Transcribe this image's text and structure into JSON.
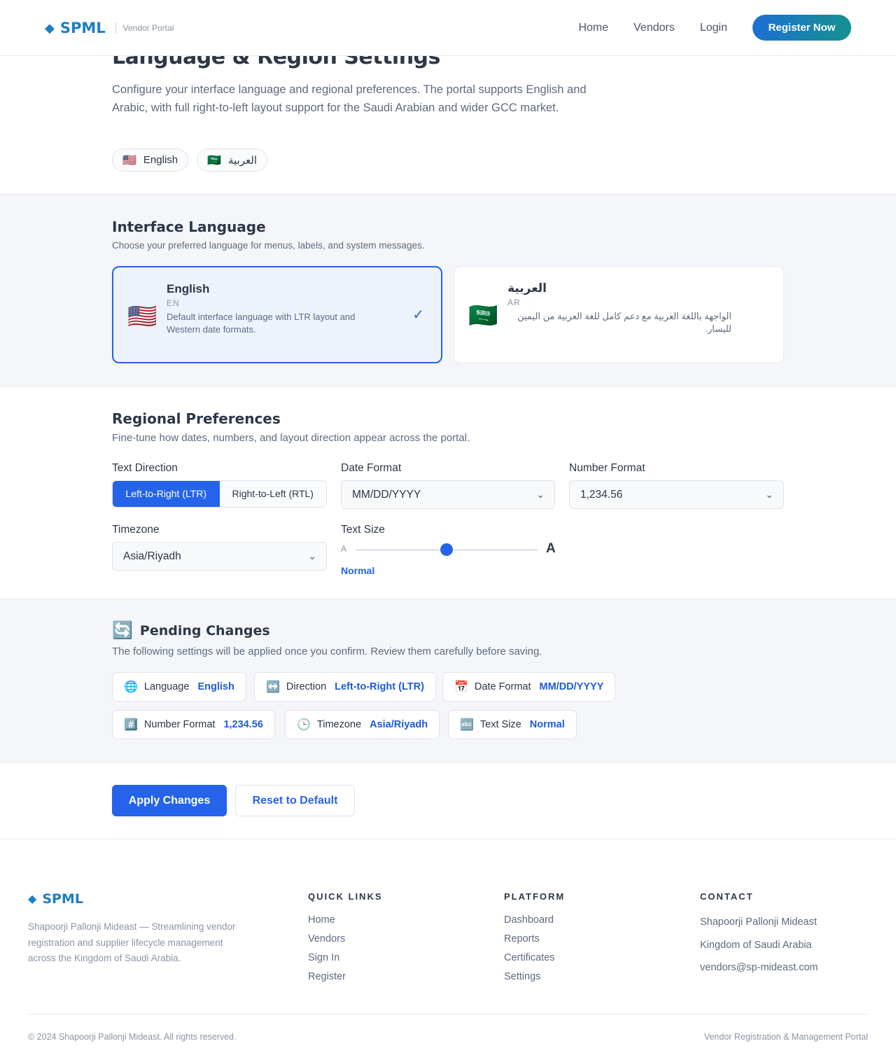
{
  "header": {
    "brand": "SPML",
    "subtitle": "Vendor Portal",
    "nav": [
      "Home",
      "Vendors",
      "Login"
    ],
    "cta": "Register Now"
  },
  "hero": {
    "title": "Language & Region Settings",
    "description": "Configure your interface language and regional preferences. The portal supports English and Arabic, with full right-to-left layout support for the Saudi Arabian and wider GCC market.",
    "chips": [
      {
        "flag": "🇺🇸",
        "label": "English"
      },
      {
        "flag": "🇸🇦",
        "label": "العربية"
      }
    ]
  },
  "interface_language": {
    "title": "Interface Language",
    "subtitle": "Choose your preferred language for menus, labels, and system messages.",
    "options": [
      {
        "flag": "🇺🇸",
        "name": "English",
        "code": "EN",
        "desc": "Default interface language with LTR layout and Western date formats.",
        "check": "✓"
      },
      {
        "flag": "🇸🇦",
        "name": "العربية",
        "code": "AR",
        "desc": "الواجهة باللغة العربية مع دعم كامل للغة العربية من اليمين لليسار."
      }
    ]
  },
  "regional": {
    "title": "Regional Preferences",
    "subtitle": "Fine-tune how dates, numbers, and layout direction appear across the portal.",
    "text_direction_label": "Text Direction",
    "direction_options": [
      "Left-to-Right (LTR)",
      "Right-to-Left (RTL)"
    ],
    "date_format_label": "Date Format",
    "date_format_value": "MM/DD/YYYY",
    "number_format_label": "Number Format",
    "number_format_value": "1,234.56",
    "timezone_label": "Timezone",
    "timezone_value": "Asia/Riyadh",
    "text_size_label": "Text Size",
    "text_size_small": "A",
    "text_size_large": "A",
    "text_size_level": 0.5,
    "text_size_value": "Normal"
  },
  "pending": {
    "icon": "🔄",
    "title": "Pending Changes",
    "subtitle": "The following settings will be applied once you confirm. Review them carefully before saving.",
    "items": [
      {
        "icon": "🌐",
        "label": "Language",
        "value": "English"
      },
      {
        "icon": "↔️",
        "label": "Direction",
        "value": "Left-to-Right (LTR)"
      },
      {
        "icon": "📅",
        "label": "Date Format",
        "value": "MM/DD/YYYY"
      },
      {
        "icon": "#️⃣",
        "label": "Number Format",
        "value": "1,234.56"
      },
      {
        "icon": "🕒",
        "label": "Timezone",
        "value": "Asia/Riyadh"
      },
      {
        "icon": "🔤",
        "label": "Text Size",
        "value": "Normal"
      }
    ]
  },
  "actions": {
    "apply": "Apply Changes",
    "reset": "Reset to Default"
  },
  "footer": {
    "brand": "SPML",
    "description": "Shapoorji Pallonji Mideast — Streamlining vendor registration and supplier lifecycle management across the Kingdom of Saudi Arabia.",
    "quick_links_title": "QUICK LINKS",
    "quick_links": [
      "Home",
      "Vendors",
      "Sign In",
      "Register"
    ],
    "platform_title": "PLATFORM",
    "platform_links": [
      "Dashboard",
      "Reports",
      "Certificates",
      "Settings"
    ],
    "contact_title": "CONTACT",
    "contact_lines": [
      "Shapoorji Pallonji Mideast",
      "Kingdom of Saudi Arabia",
      "vendors@sp-mideast.com"
    ],
    "copyright": "© 2024 Shapoorji Pallonji Mideast. All rights reserved.",
    "tagline": "Vendor Registration & Management Portal"
  },
  "colors": {
    "accent": "#2563eb",
    "brand": "#1e7fc2"
  }
}
